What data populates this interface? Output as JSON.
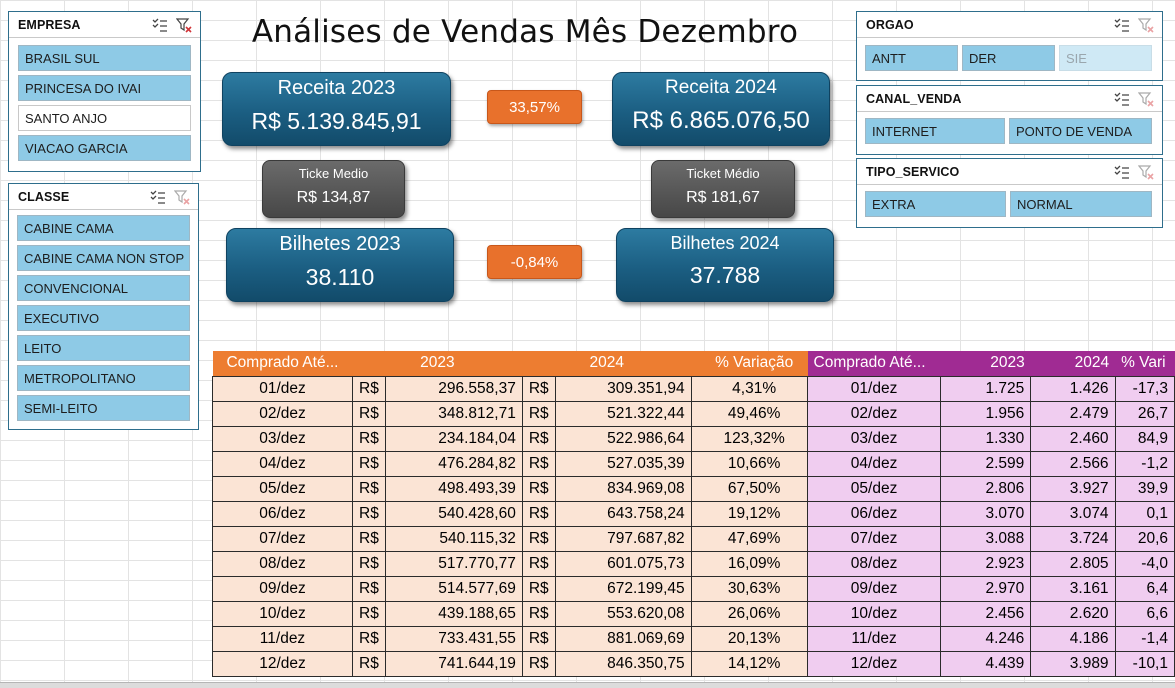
{
  "title": "Análises de Vendas Mês Dezembro",
  "slicers": {
    "empresa": {
      "title": "EMPRESA",
      "items": [
        {
          "label": "BRASIL SUL",
          "selected": true
        },
        {
          "label": "PRINCESA DO IVAI",
          "selected": true
        },
        {
          "label": "SANTO ANJO",
          "selected": false
        },
        {
          "label": "VIACAO GARCIA",
          "selected": true
        }
      ]
    },
    "classe": {
      "title": "CLASSE",
      "items": [
        {
          "label": "CABINE CAMA"
        },
        {
          "label": "CABINE CAMA NON STOP"
        },
        {
          "label": "CONVENCIONAL"
        },
        {
          "label": "EXECUTIVO"
        },
        {
          "label": "LEITO"
        },
        {
          "label": "METROPOLITANO"
        },
        {
          "label": "SEMI-LEITO"
        }
      ]
    },
    "orgao": {
      "title": "ORGAO",
      "items": [
        {
          "label": "ANTT"
        },
        {
          "label": "DER"
        },
        {
          "label": "SIE"
        }
      ]
    },
    "canal_venda": {
      "title": "CANAL_VENDA",
      "items": [
        {
          "label": "INTERNET"
        },
        {
          "label": "PONTO DE VENDA"
        }
      ]
    },
    "tipo_servico": {
      "title": "TIPO_SERVICO",
      "items": [
        {
          "label": "EXTRA"
        },
        {
          "label": "NORMAL"
        }
      ]
    }
  },
  "kpis": {
    "receita_2023": {
      "label": "Receita 2023",
      "value": "R$ 5.139.845,91"
    },
    "receita_2024": {
      "label": "Receita 2024",
      "value": "R$ 6.865.076,50"
    },
    "receita_var": "33,57%",
    "ticket_2023": {
      "label": "Ticke Medio",
      "value": "R$ 134,87"
    },
    "ticket_2024": {
      "label": "Ticket Médio",
      "value": "R$ 181,67"
    },
    "bilhetes_2023": {
      "label": "Bilhetes 2023",
      "value": "38.110"
    },
    "bilhetes_2024": {
      "label": "Bilhetes 2024",
      "value": "37.788"
    },
    "bilhetes_var": "-0,84%"
  },
  "revenue_table": {
    "headers": [
      "Comprado Até...",
      "2023",
      "2024",
      "% Variação"
    ],
    "currency": "R$",
    "rows": [
      [
        "01/dez",
        "296.558,37",
        "309.351,94",
        "4,31%"
      ],
      [
        "02/dez",
        "348.812,71",
        "521.322,44",
        "49,46%"
      ],
      [
        "03/dez",
        "234.184,04",
        "522.986,64",
        "123,32%"
      ],
      [
        "04/dez",
        "476.284,82",
        "527.035,39",
        "10,66%"
      ],
      [
        "05/dez",
        "498.493,39",
        "834.969,08",
        "67,50%"
      ],
      [
        "06/dez",
        "540.428,60",
        "643.758,24",
        "19,12%"
      ],
      [
        "07/dez",
        "540.115,32",
        "797.687,82",
        "47,69%"
      ],
      [
        "08/dez",
        "517.770,77",
        "601.075,73",
        "16,09%"
      ],
      [
        "09/dez",
        "514.577,69",
        "672.199,45",
        "30,63%"
      ],
      [
        "10/dez",
        "439.188,65",
        "553.620,08",
        "26,06%"
      ],
      [
        "11/dez",
        "733.431,55",
        "881.069,69",
        "20,13%"
      ],
      [
        "12/dez",
        "741.644,19",
        "846.350,75",
        "14,12%"
      ]
    ]
  },
  "tickets_table": {
    "headers": [
      "Comprado Até...",
      "2023",
      "2024",
      "% Vari"
    ],
    "rows": [
      [
        "01/dez",
        "1.725",
        "1.426",
        "-17,3"
      ],
      [
        "02/dez",
        "1.956",
        "2.479",
        "26,7"
      ],
      [
        "03/dez",
        "1.330",
        "2.460",
        "84,9"
      ],
      [
        "04/dez",
        "2.599",
        "2.566",
        "-1,2"
      ],
      [
        "05/dez",
        "2.806",
        "3.927",
        "39,9"
      ],
      [
        "06/dez",
        "3.070",
        "3.074",
        "0,1"
      ],
      [
        "07/dez",
        "3.088",
        "3.724",
        "20,6"
      ],
      [
        "08/dez",
        "2.923",
        "2.805",
        "-4,0"
      ],
      [
        "09/dez",
        "2.970",
        "3.161",
        "6,4"
      ],
      [
        "10/dez",
        "2.456",
        "2.620",
        "6,6"
      ],
      [
        "11/dez",
        "4.246",
        "4.186",
        "-1,4"
      ],
      [
        "12/dez",
        "4.439",
        "3.989",
        "-10,1"
      ]
    ]
  }
}
